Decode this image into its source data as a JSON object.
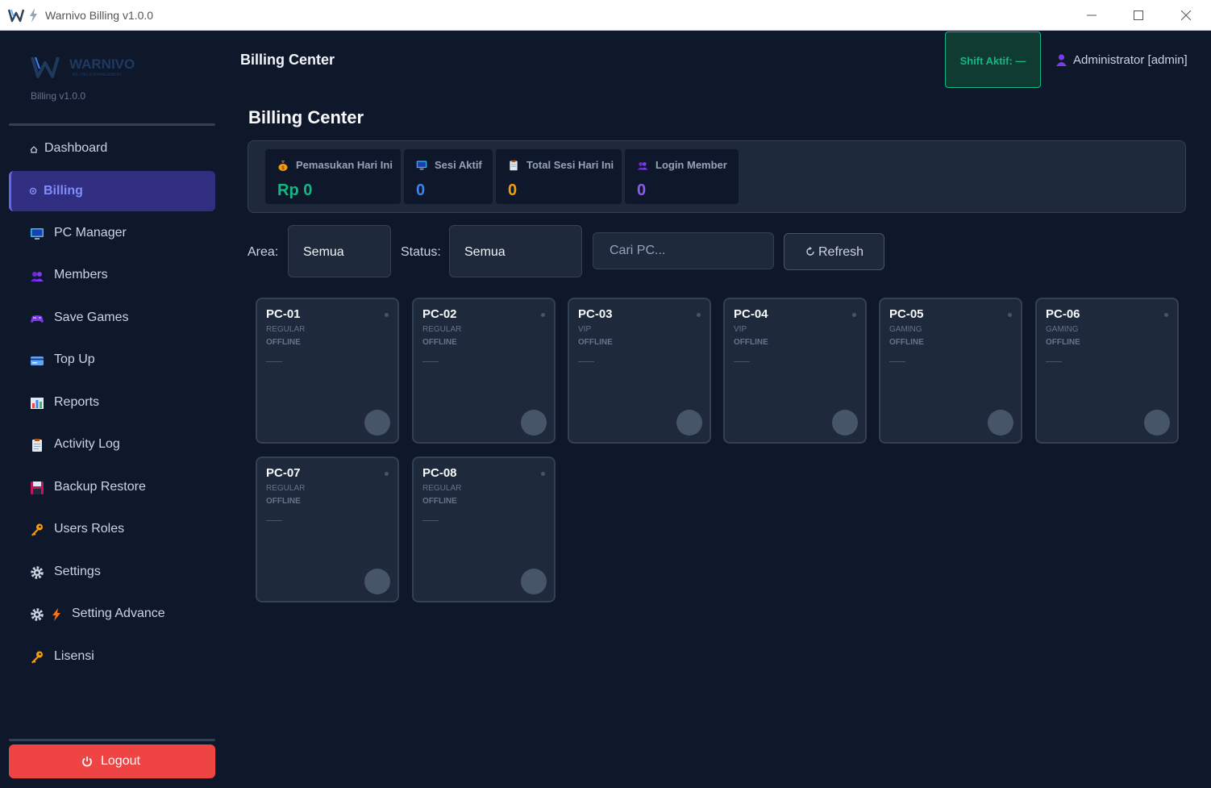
{
  "window": {
    "title": "Warnivo Billing v1.0.0"
  },
  "brand": {
    "name": "WARNIVO",
    "tagline": "BILLING & MANAGEMENT",
    "version": "Billing v1.0.0"
  },
  "sidebar": {
    "items": [
      {
        "label": "Dashboard",
        "icon": "home-icon"
      },
      {
        "label": "Billing",
        "icon": "dot-icon",
        "active": true
      },
      {
        "label": "PC Manager",
        "icon": "monitor-icon"
      },
      {
        "label": "Members",
        "icon": "members-icon"
      },
      {
        "label": "Save Games",
        "icon": "gamepad-icon"
      },
      {
        "label": "Top Up",
        "icon": "credit-card-icon"
      },
      {
        "label": "Reports",
        "icon": "bar-chart-icon"
      },
      {
        "label": "Activity Log",
        "icon": "clipboard-icon"
      },
      {
        "label": "Backup  Restore",
        "icon": "floppy-icon"
      },
      {
        "label": "Users  Roles",
        "icon": "key-icon"
      },
      {
        "label": "Settings",
        "icon": "gear-icon"
      },
      {
        "label": "Setting Advance",
        "icon": "gear-bolt-icon"
      },
      {
        "label": "Lisensi",
        "icon": "key-icon"
      }
    ],
    "logout_label": "Logout"
  },
  "header": {
    "title": "Billing Center",
    "shift_label": "Shift Aktif: —",
    "user": "Administrator  [admin]"
  },
  "main": {
    "title": "Billing Center",
    "stats": [
      {
        "label": "Pemasukan Hari Ini",
        "value": "Rp 0",
        "color": "#10b981",
        "icon": "money-bag-icon"
      },
      {
        "label": "Sesi Aktif",
        "value": "0",
        "color": "#3b82f6",
        "icon": "monitor-icon"
      },
      {
        "label": "Total Sesi Hari Ini",
        "value": "0",
        "color": "#f59e0b",
        "icon": "clipboard-icon"
      },
      {
        "label": "Login Member",
        "value": "0",
        "color": "#8b5cf6",
        "icon": "members-icon"
      }
    ],
    "filters": {
      "area_label": "Area:",
      "area_value": "Semua",
      "status_label": "Status:",
      "status_value": "Semua",
      "search_placeholder": "Cari PC...",
      "refresh_label": "Refresh"
    },
    "pcs": [
      {
        "name": "PC-01",
        "type": "REGULAR",
        "status": "OFFLINE"
      },
      {
        "name": "PC-02",
        "type": "REGULAR",
        "status": "OFFLINE"
      },
      {
        "name": "PC-03",
        "type": "VIP",
        "status": "OFFLINE"
      },
      {
        "name": "PC-04",
        "type": "VIP",
        "status": "OFFLINE"
      },
      {
        "name": "PC-05",
        "type": "GAMING",
        "status": "OFFLINE"
      },
      {
        "name": "PC-06",
        "type": "GAMING",
        "status": "OFFLINE"
      },
      {
        "name": "PC-07",
        "type": "REGULAR",
        "status": "OFFLINE"
      },
      {
        "name": "PC-08",
        "type": "REGULAR",
        "status": "OFFLINE"
      }
    ]
  }
}
